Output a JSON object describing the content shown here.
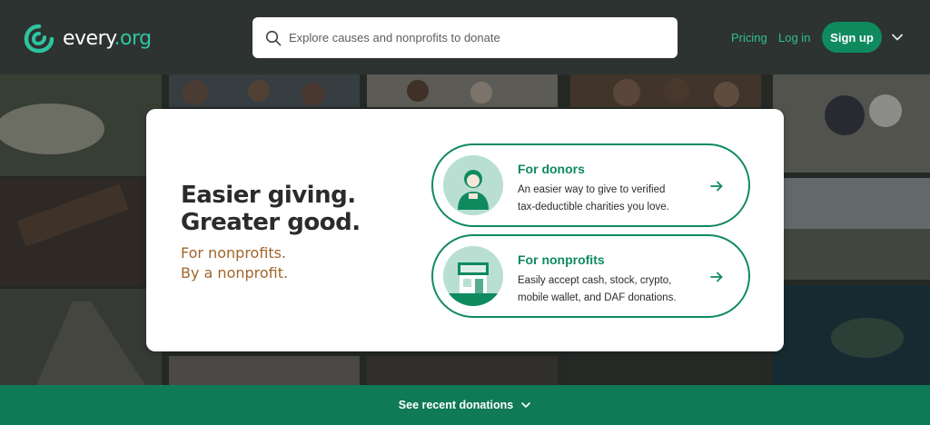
{
  "header": {
    "logo_text": "every",
    "logo_suffix": ".org",
    "search_placeholder": "Explore causes and nonprofits to donate",
    "pricing_label": "Pricing",
    "login_label": "Log in",
    "signup_label": "Sign up"
  },
  "hero": {
    "headline_line1": "Easier giving.",
    "headline_line2": "Greater good.",
    "subline_line1": "For nonprofits.",
    "subline_line2": "By a nonprofit."
  },
  "options": [
    {
      "title": "For donors",
      "desc_line1": "An easier way to give to verified",
      "desc_line2": "tax-deductible charities you love.",
      "icon": "donor-person-icon"
    },
    {
      "title": "For nonprofits",
      "desc_line1": "Easily accept cash, stock, crypto,",
      "desc_line2": "mobile wallet, and DAF donations.",
      "icon": "storefront-icon"
    }
  ],
  "footer": {
    "label": "See recent donations"
  },
  "colors": {
    "brand_green": "#0f8a5f",
    "accent_teal": "#2ec4a0",
    "subline_brown": "#a0652a",
    "header_bg": "#2d3330"
  }
}
